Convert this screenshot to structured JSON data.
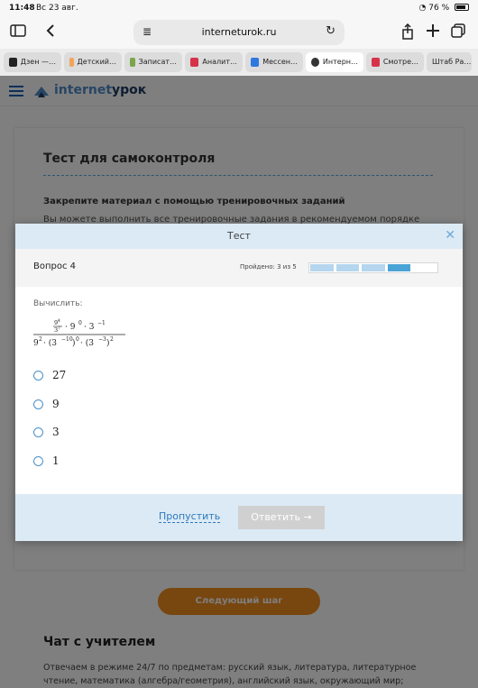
{
  "status": {
    "time": "11:48",
    "date": "Вс 23 авг.",
    "battery": "76 %"
  },
  "browser": {
    "url": "interneturok.ru",
    "tabs": [
      {
        "label": "Дзен —…",
        "color": "#222222"
      },
      {
        "label": "Детский…",
        "color": "#f2a45a"
      },
      {
        "label": "Записат…",
        "color": "#7aa54a"
      },
      {
        "label": "Аналит…",
        "color": "#d6334a"
      },
      {
        "label": "Мессен…",
        "color": "#2f78e0"
      },
      {
        "label": "Интерн…",
        "color": "#333333"
      },
      {
        "label": "Смотре…",
        "color": "#d6334a"
      },
      {
        "label": "Штаб Ра…",
        "color": ""
      }
    ]
  },
  "site": {
    "logo_a": "internet",
    "logo_b": "урок",
    "test_title": "Тест для самоконтроля",
    "subheading": "Закрепите материал с помощью тренировочных заданий",
    "subtext": "Вы можете выполнить все тренировочные задания в рекомендуемом порядке или",
    "next_step": "Следующий шаг",
    "chat_title": "Чат с учителем",
    "chat_text": "Отвечаем в режиме 24/7 по предметам: русский язык, литература, литературное чтение, математика (алгебра/геометрия), английский язык, окружающий мир;"
  },
  "modal": {
    "title": "Тест",
    "question": "Вопрос 4",
    "passed_label": "Пройдено: 3 из 5",
    "progress_done": 3,
    "progress_current": 4,
    "progress_total": 5,
    "prompt": "Вычислить:",
    "answers": [
      "27",
      "9",
      "3",
      "1"
    ],
    "skip": "Пропустить",
    "submit": "Ответить"
  },
  "colors": {
    "accent": "#4e8bc9",
    "modal_header": "#dbeaf5",
    "orange": "#f08c1e",
    "progress_done": "#b5d6ee",
    "progress_current": "#4aa3d6"
  }
}
